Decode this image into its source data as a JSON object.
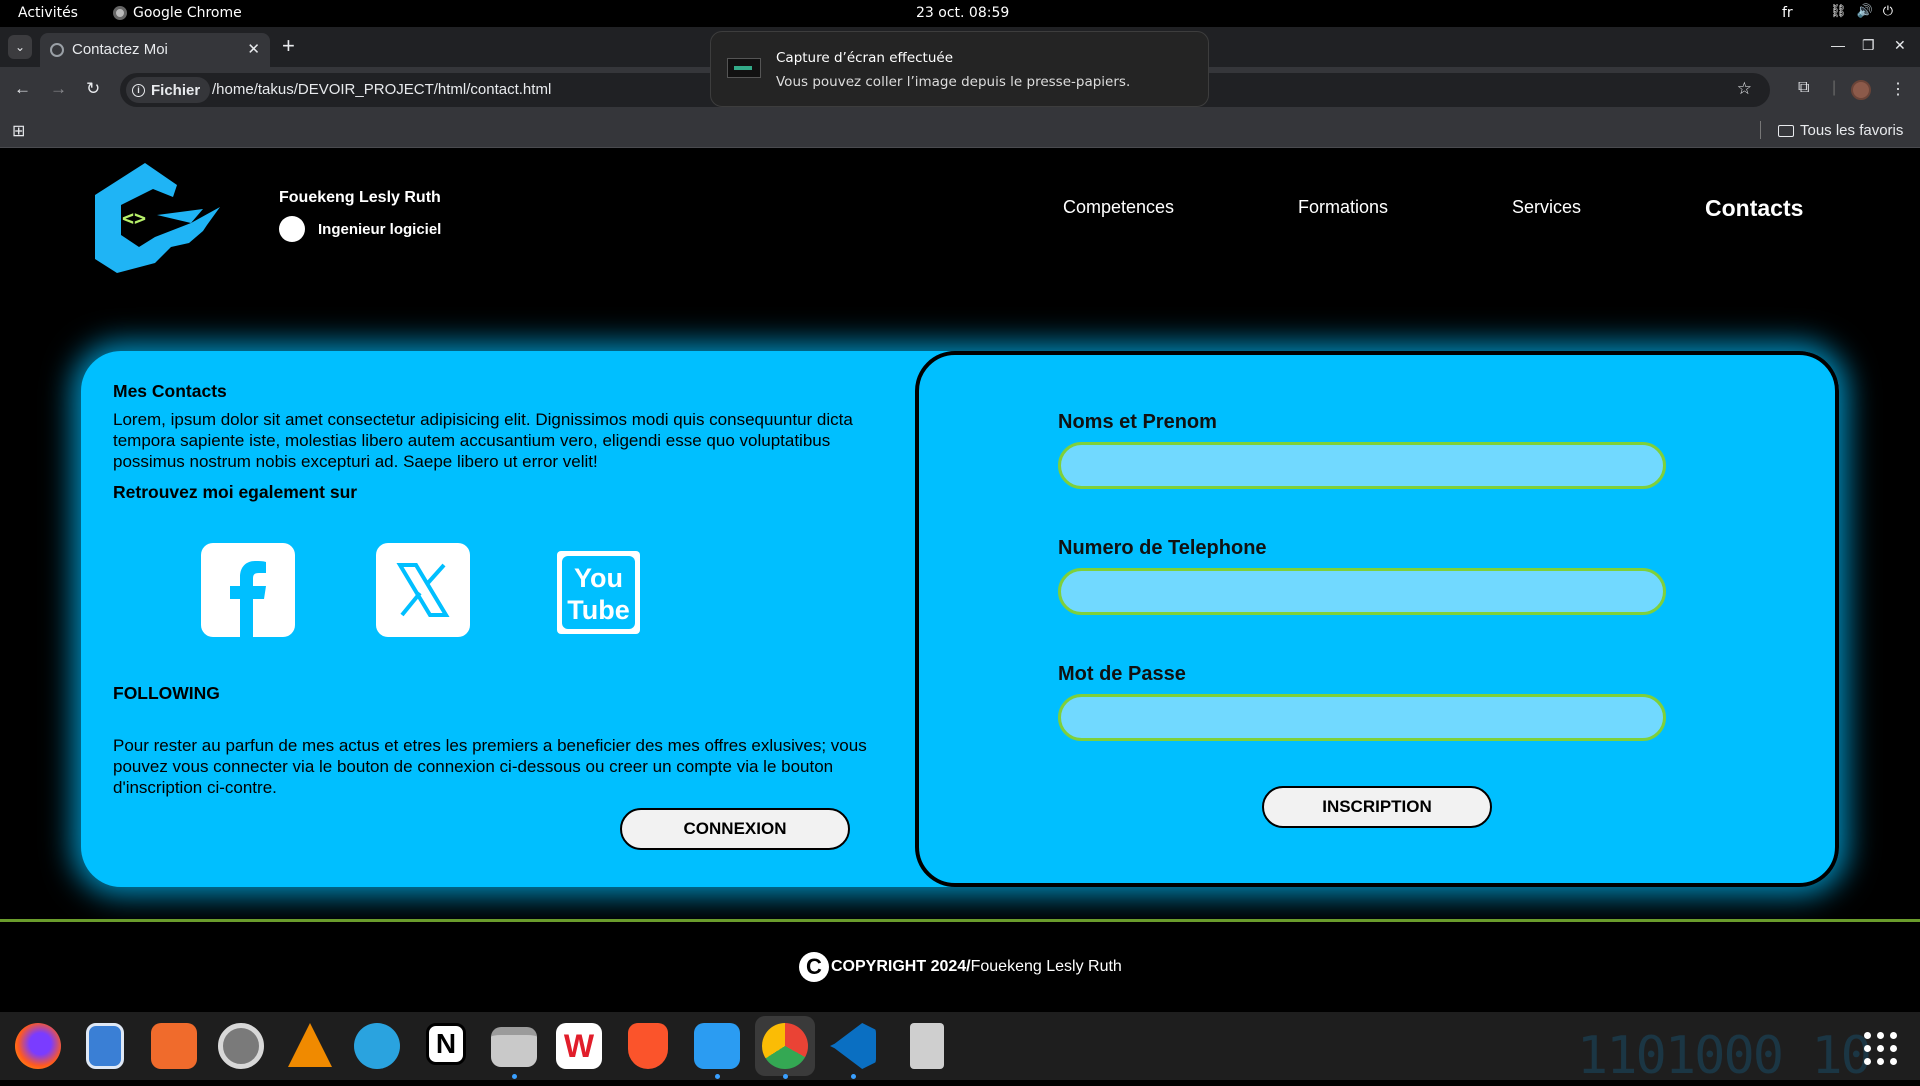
{
  "system": {
    "activities": "Activités",
    "app_name": "Google Chrome",
    "clock": "23 oct.  08:59",
    "lang": "fr"
  },
  "browser": {
    "tab_title": "Contactez Moi",
    "url_chip": "Fichier",
    "url": "/home/takus/DEVOIR_PROJECT/html/contact.html",
    "bookmarks_folder": "Tous les favoris"
  },
  "notification": {
    "title": "Capture d’écran effectuée",
    "body": "Vous pouvez coller l’image depuis le presse-papiers."
  },
  "header": {
    "name": "Fouekeng Lesly Ruth",
    "role": "Ingenieur logiciel",
    "logo_text": "<>",
    "nav": [
      "Competences",
      "Formations",
      "Services",
      "Contacts"
    ],
    "active_nav": "Contacts"
  },
  "contacts": {
    "title": "Mes Contacts",
    "text": "Lorem, ipsum dolor sit amet consectetur adipisicing elit. Dignissimos modi quis consequuntur dicta tempora sapiente iste, molestias libero autem accusantium vero, eligendi esse quo voluptatibus possimus nostrum nobis excepturi ad. Saepe libero ut error velit!",
    "social_title": "Retrouvez moi egalement sur",
    "social": [
      "facebook",
      "x",
      "youtube"
    ],
    "youtube_top": "You",
    "youtube_bottom": "Tube",
    "following_title": "FOLLOWING",
    "following_text": "Pour rester au parfun de mes actus et etres les premiers a beneficier des mes offres exlusives; vous pouvez vous connecter via le bouton de connexion ci-dessous ou creer un compte via le bouton d'inscription ci-contre.",
    "login_button": "CONNEXION"
  },
  "form": {
    "fields": [
      {
        "label": "Noms et Prenom",
        "value": ""
      },
      {
        "label": "Numero de Telephone",
        "value": ""
      },
      {
        "label": "Mot de Passe",
        "value": ""
      }
    ],
    "submit": "INSCRIPTION"
  },
  "footer": {
    "symbol": "C",
    "copyright": "COPYRIGHT 2024/",
    "author": "Fouekeng Lesly Ruth"
  },
  "dock": {
    "apps": [
      "firefox",
      "text-editor",
      "app-center",
      "settings",
      "vlc",
      "telegram",
      "notion",
      "files",
      "wps-office",
      "brave",
      "kdenlive-editor",
      "google-chrome",
      "vscode",
      "trash"
    ],
    "background_text": "1101000  10"
  },
  "colors": {
    "panel": "#00bfff",
    "input": "#71d9ff",
    "input_border": "#7fd03a",
    "footer_line": "#6a9c2c"
  }
}
